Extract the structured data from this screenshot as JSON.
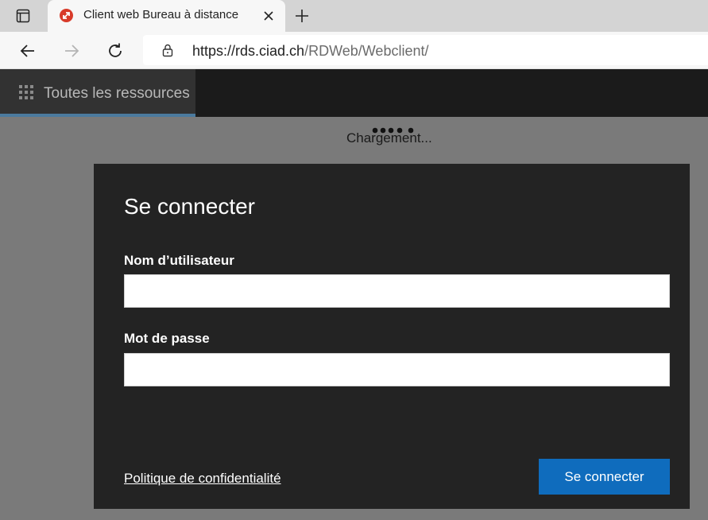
{
  "browser": {
    "tab": {
      "title": "Client web Bureau à distance",
      "favicon": "rdp-icon"
    },
    "address": {
      "host": "https://rds.ciad.ch",
      "path": "/RDWeb/Webclient/"
    }
  },
  "app": {
    "nav": {
      "resources_label": "Toutes les ressources"
    },
    "loading_text": "Chargement..."
  },
  "login": {
    "title": "Se connecter",
    "username_label": "Nom d’utilisateur",
    "username_value": "",
    "password_label": "Mot de passe",
    "password_value": "",
    "privacy_link": "Politique de confidentialité",
    "submit_label": "Se connecter"
  },
  "colors": {
    "accent": "#0f6cbd",
    "dialog_bg": "#232323",
    "appbar_bg": "#1b1b1b",
    "overlay_bg": "#7a7a7a",
    "favicon": "#d83b2a"
  }
}
